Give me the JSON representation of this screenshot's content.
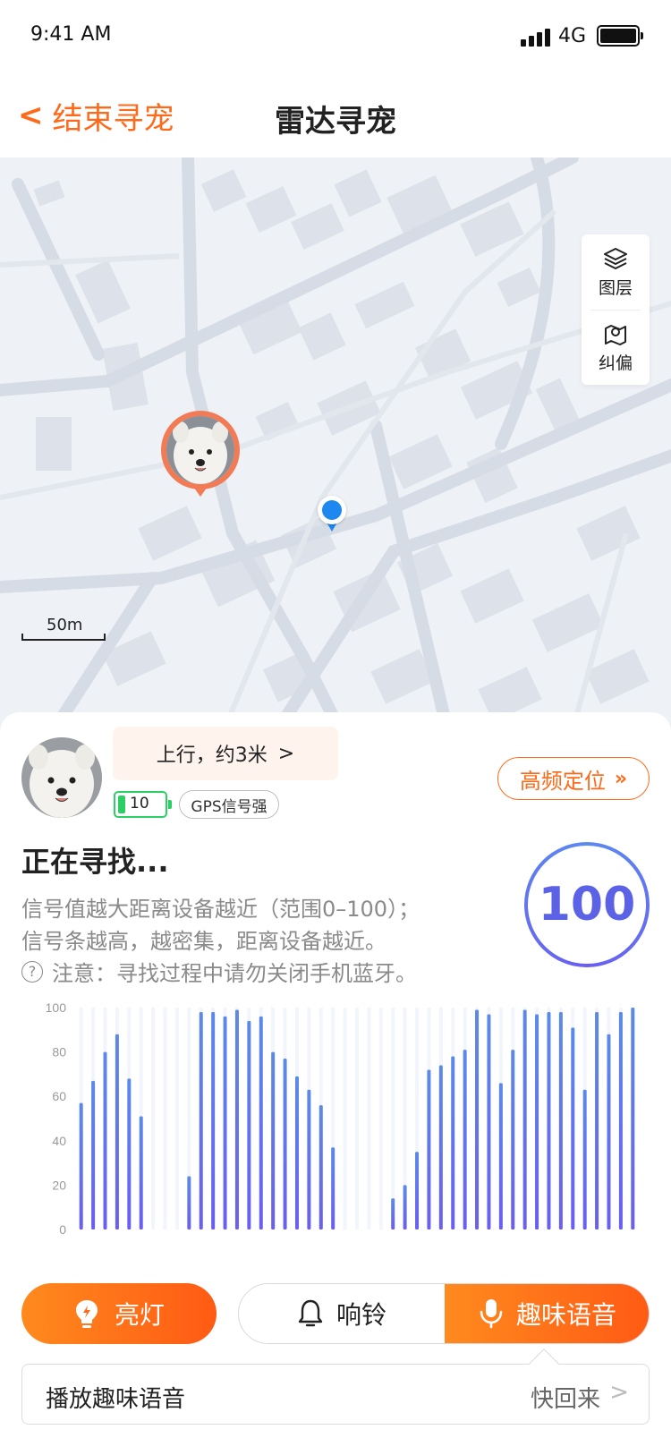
{
  "status": {
    "time": "9:41 AM",
    "network": "4G"
  },
  "nav": {
    "back_label": "结束寻宠",
    "title": "雷达寻宠"
  },
  "map": {
    "layers_label": "图层",
    "correct_label": "纠偏",
    "scale_label": "50m"
  },
  "card": {
    "direction": "上行，约3米",
    "battery": "10",
    "gps": "GPS信号强",
    "freq_button": "高频定位",
    "searching": "正在寻找...",
    "hint1": "信号值越大距离设备越近（范围0–100）；",
    "hint2": "信号条越高，越密集，距离设备越近。",
    "hint3": "注意：寻找过程中请勿关闭手机蓝牙。",
    "signal_value": "100"
  },
  "chart_data": {
    "type": "bar",
    "ylim": [
      0,
      100
    ],
    "y_ticks": [
      "100",
      "80",
      "60",
      "40",
      "20",
      "0"
    ],
    "values": [
      57,
      67,
      80,
      88,
      68,
      51,
      0,
      0,
      0,
      24,
      98,
      98,
      96,
      99,
      94,
      96,
      80,
      77,
      69,
      63,
      56,
      37,
      0,
      0,
      0,
      0,
      14,
      20,
      35,
      72,
      74,
      78,
      81,
      99,
      97,
      66,
      81,
      99,
      97,
      98,
      98,
      91,
      63,
      98,
      88,
      98,
      100
    ]
  },
  "actions": {
    "light": "亮灯",
    "ring": "响铃",
    "voice": "趣味语音",
    "voice_row_label": "播放趣味语音",
    "voice_row_value": "快回来"
  },
  "colors": {
    "accent": "#ff6a1a",
    "bar": "#5b7fe8",
    "battery": "#2ccf63",
    "user_dot": "#1e88f0"
  }
}
